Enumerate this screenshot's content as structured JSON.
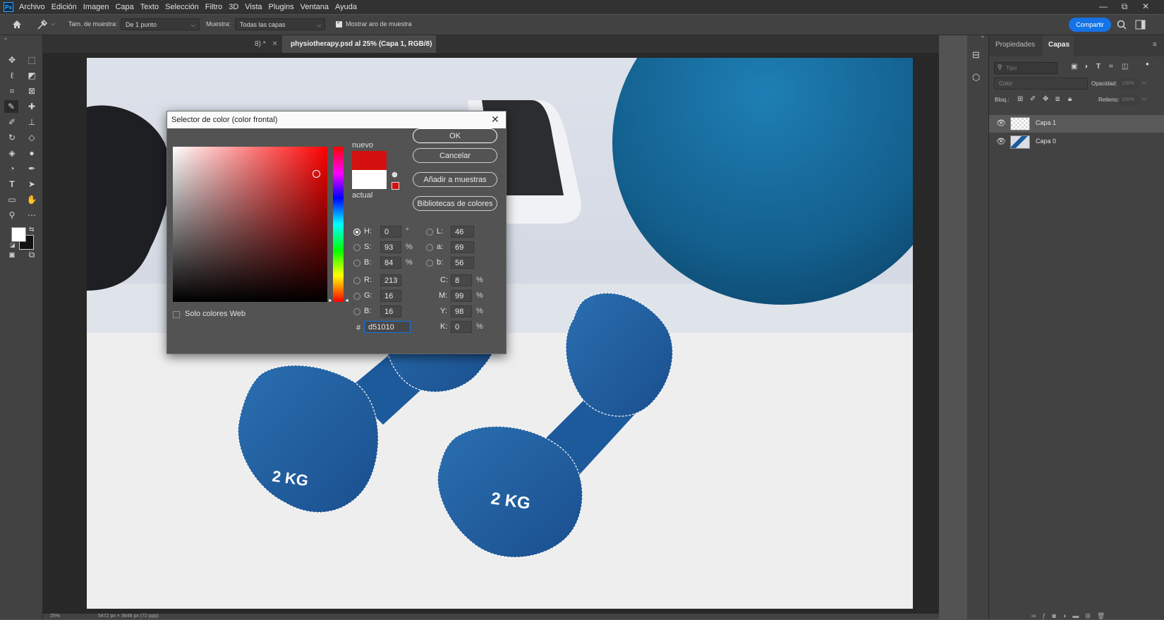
{
  "app": {
    "logo": "Ps"
  },
  "menu": [
    "Archivo",
    "Edición",
    "Imagen",
    "Capa",
    "Texto",
    "Selección",
    "Filtro",
    "3D",
    "Vista",
    "Plugins",
    "Ventana",
    "Ayuda"
  ],
  "window_controls": [
    "—",
    "⧉",
    "✕"
  ],
  "options": {
    "sample_size_label": "Tam. de muestra:",
    "sample_size_value": "De 1 punto",
    "sample_label": "Muestra:",
    "sample_value": "Todas las capas",
    "show_ring_label": "Mostrar aro de muestra",
    "share_label": "Compartir"
  },
  "tabs": [
    {
      "label": "8) *",
      "active": false
    },
    {
      "label": "physiotherapy.psd al 25% (Capa 1, RGB/8)",
      "active": true
    }
  ],
  "canvas": {
    "weight_labels": [
      "2 KG",
      "2 KG"
    ]
  },
  "color_picker": {
    "title": "Selector de color (color frontal)",
    "new_label": "nuevo",
    "current_label": "actual",
    "new_color": "#d51010",
    "current_color": "#ffffff",
    "buttons": [
      "OK",
      "Cancelar",
      "Añadir a muestras",
      "Bibliotecas de colores"
    ],
    "web_only_label": "Solo colores Web",
    "hsb": [
      {
        "label": "H:",
        "value": "0",
        "unit": "°",
        "selected": true
      },
      {
        "label": "S:",
        "value": "93",
        "unit": "%",
        "selected": false
      },
      {
        "label": "B:",
        "value": "84",
        "unit": "%",
        "selected": false
      }
    ],
    "rgb": [
      {
        "label": "R:",
        "value": "213"
      },
      {
        "label": "G:",
        "value": "16"
      },
      {
        "label": "B:",
        "value": "16"
      }
    ],
    "lab": [
      {
        "label": "L:",
        "value": "46"
      },
      {
        "label": "a:",
        "value": "69"
      },
      {
        "label": "b:",
        "value": "56"
      }
    ],
    "cmyk": [
      {
        "label": "C:",
        "value": "8",
        "unit": "%"
      },
      {
        "label": "M:",
        "value": "99",
        "unit": "%"
      },
      {
        "label": "Y:",
        "value": "98",
        "unit": "%"
      },
      {
        "label": "K:",
        "value": "0",
        "unit": "%"
      }
    ],
    "hex_label": "#",
    "hex_value": "d51010"
  },
  "panel": {
    "tabs": [
      "Propiedades",
      "Capas"
    ],
    "search_placeholder": "Tipo",
    "blend_mode": "Color",
    "opacity_label": "Opacidad:",
    "opacity_value": "100%",
    "lock_label": "Bloq.:",
    "fill_label": "Relleno:",
    "fill_value": "100%",
    "layers": [
      {
        "name": "Capa 1",
        "selected": true
      },
      {
        "name": "Capa 0",
        "selected": false
      }
    ]
  },
  "status": {
    "zoom": "25%",
    "doc_size": "5472 px × 3648 px (72 ppp)"
  }
}
